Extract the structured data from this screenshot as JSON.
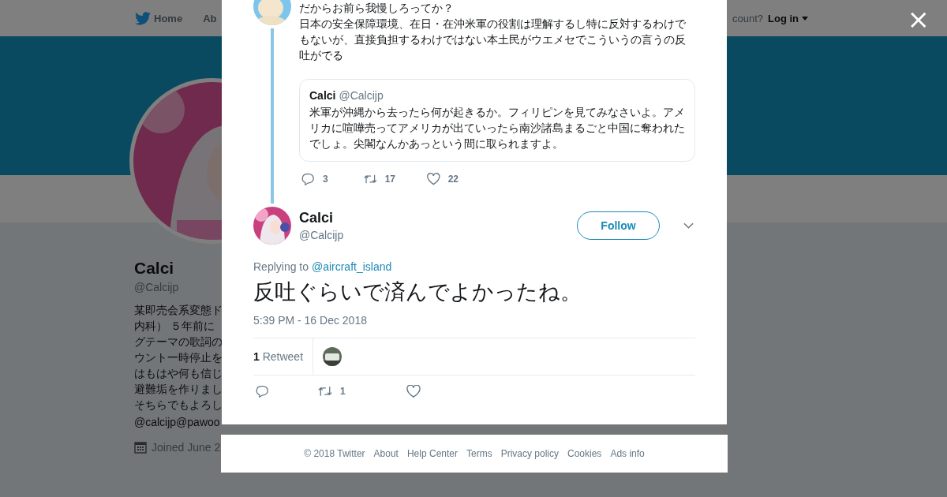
{
  "nav": {
    "items": [
      {
        "label": "Home"
      },
      {
        "label": "Ab"
      }
    ],
    "account_prompt": "count?",
    "login": "Log in"
  },
  "profile": {
    "name": "Calci",
    "handle": "@Calcijp",
    "bio_lines": [
      "某即売会系変態ド",
      "内科） ５年前に",
      "グテーマの歌詞の",
      "ウント一時停止を",
      "はもはや何も信じ",
      "避難垢を作りまし",
      "そちらでもよろし"
    ],
    "link": "@calcijp@pawoo",
    "joined": "Joined June 2"
  },
  "close": "×",
  "parent_tweet": {
    "lines": [
      "だからお前ら我慢しろってか？",
      "日本の安全保障環境、在日・在沖米軍の役割は理解するし特に反対するわけでもないが、直接負担するわけではない本土民がウエメセでこういうの言うの反吐がでる"
    ],
    "quote": {
      "name": "Calci",
      "handle": "@Calcijp",
      "text": "米軍が沖縄から去ったら何が起きるか。フィリピンを見てみなさいよ。アメリカに喧嘩売ってアメリカが出ていったら南沙諸島まるごと中国に奪われたでしょ。尖閣なんかあっという間に取られますよ。"
    },
    "replies": "3",
    "retweets": "17",
    "likes": "22"
  },
  "tweet": {
    "name": "Calci",
    "handle": "@Calcijp",
    "follow": "Follow",
    "replying_label": "Replying to",
    "replying_to": "@aircraft_island",
    "text": "反吐ぐらいで済んでよかったね。",
    "timestamp": "5:39 PM - 16 Dec 2018",
    "retweet_count": "1",
    "retweet_label": "Retweet",
    "retweets": "1"
  },
  "footer": [
    "© 2018 Twitter",
    "About",
    "Help Center",
    "Terms",
    "Privacy policy",
    "Cookies",
    "Ads info"
  ]
}
